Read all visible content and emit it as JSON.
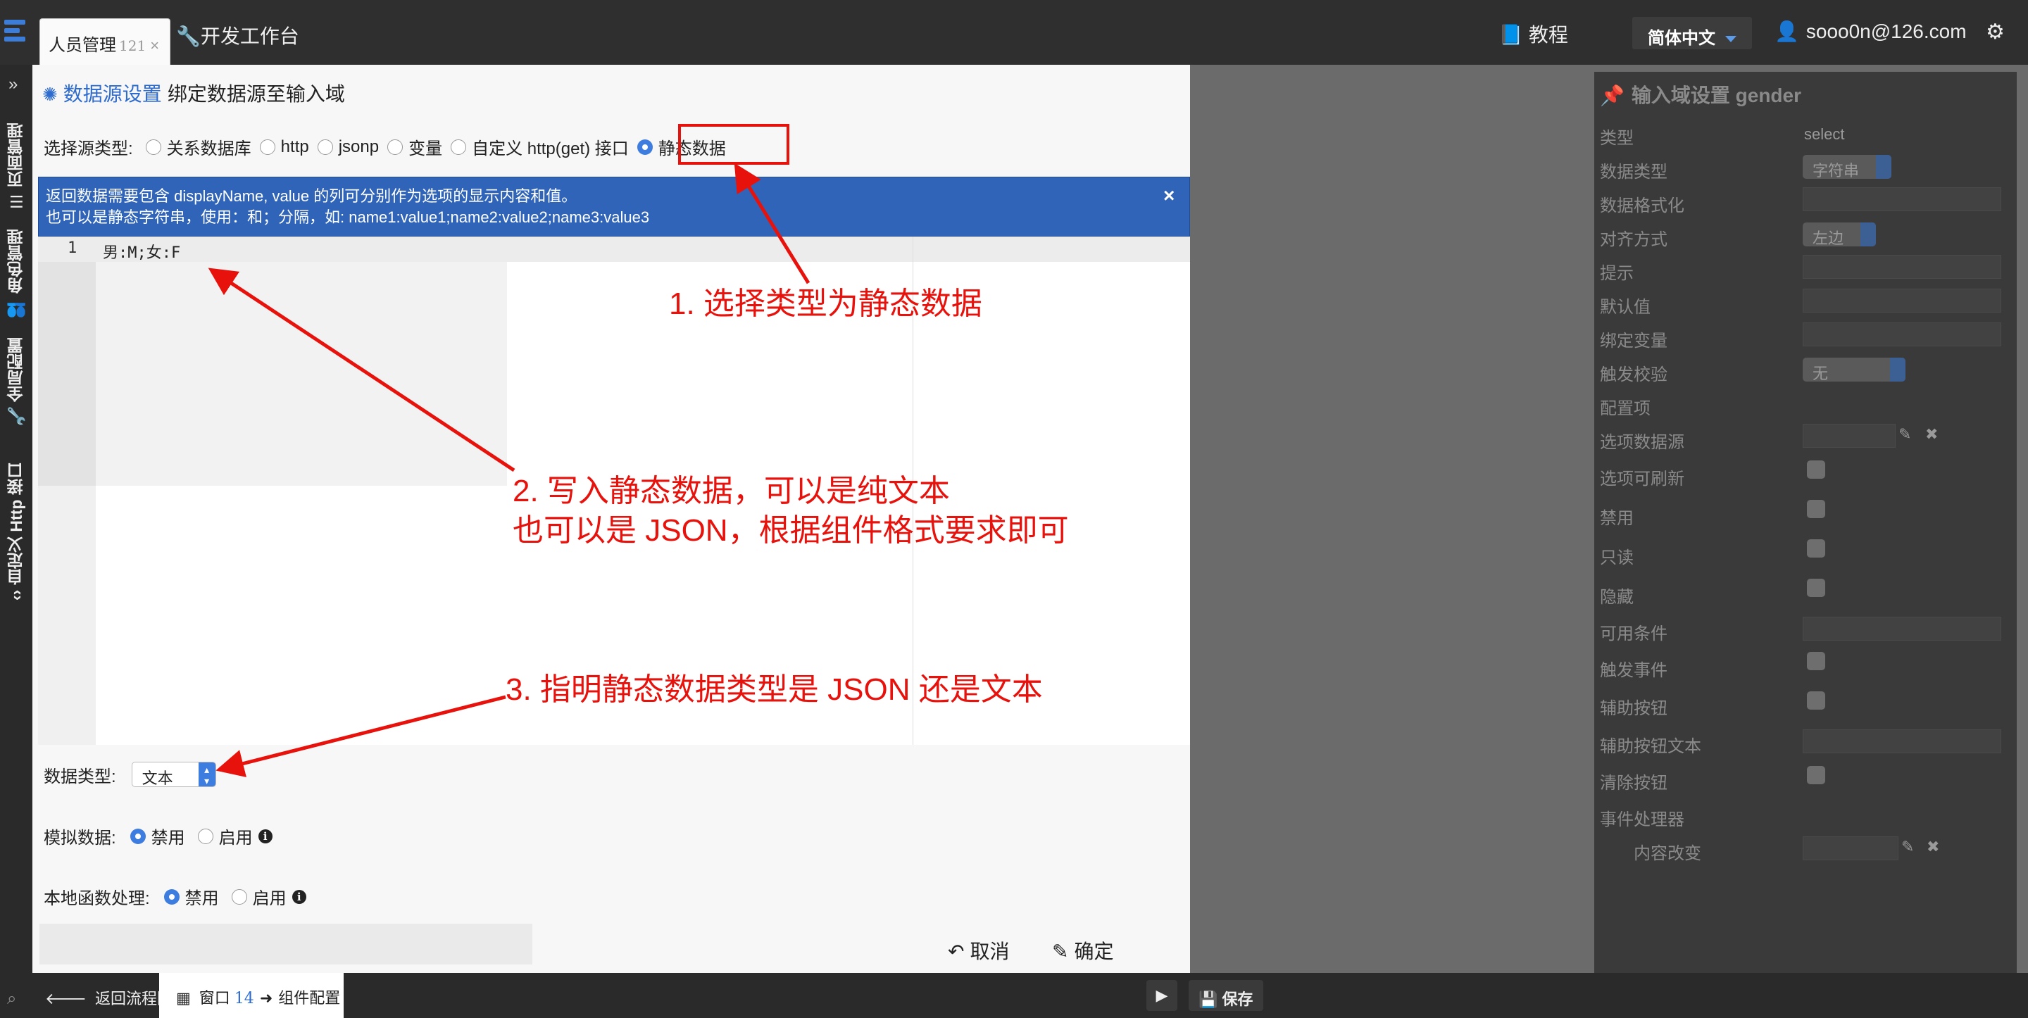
{
  "header": {
    "logo_icon": "hamburger-logo-icon",
    "tab_title": "人员管理",
    "tab_count": "121",
    "tab_close": "×",
    "devtools_label": "开发工作台",
    "tutorial_label": "教程",
    "language": "简体中文",
    "user_email": "sooo0n@126.com"
  },
  "sidebar": {
    "toggle": "»",
    "items": [
      {
        "label": "页面管理",
        "icon": "list-icon"
      },
      {
        "label": "角色管理",
        "icon": "users-icon"
      },
      {
        "label": "全局配置",
        "icon": "wrench-icon"
      },
      {
        "label": "自定义 Http 接口",
        "icon": "code-icon"
      }
    ]
  },
  "dialog": {
    "title": "数据源设置",
    "subtitle": "绑定数据源至输入域",
    "source_type_label": "选择源类型:",
    "source_options": [
      "关系数据库",
      "http",
      "jsonp",
      "变量",
      "自定义 http(get) 接口",
      "静态数据"
    ],
    "selected_source": "静态数据",
    "info_line1": "返回数据需要包含 displayName, value 的列可分别作为选项的显示内容和值。",
    "info_line2": "也可以是静态字符串，使用：和；分隔，如: name1:value1;name2:value2;name3:value3",
    "info_close": "×",
    "editor_line_number": "1",
    "editor_content": "男:M;女:F",
    "data_type_label": "数据类型:",
    "data_type_value": "文本",
    "mock_label": "模拟数据:",
    "mock_options": [
      "禁用",
      "启用"
    ],
    "local_fn_label": "本地函数处理:",
    "local_fn_options": [
      "禁用",
      "启用"
    ],
    "cancel_label": "取消",
    "ok_label": "确定"
  },
  "right_panel": {
    "title": "输入域设置 gender",
    "rows": [
      {
        "label": "类型",
        "value": "select"
      },
      {
        "label": "数据类型",
        "value": "字符串"
      },
      {
        "label": "数据格式化"
      },
      {
        "label": "对齐方式",
        "value": "左边"
      },
      {
        "label": "提示"
      },
      {
        "label": "默认值"
      },
      {
        "label": "绑定变量"
      },
      {
        "label": "触发校验",
        "value": "无"
      },
      {
        "label": "配置项"
      },
      {
        "label": "选项数据源"
      },
      {
        "label": "选项可刷新"
      },
      {
        "label": "禁用"
      },
      {
        "label": "只读"
      },
      {
        "label": "隐藏"
      },
      {
        "label": "可用条件"
      },
      {
        "label": "触发事件"
      },
      {
        "label": "辅助按钮"
      },
      {
        "label": "辅助按钮文本"
      },
      {
        "label": "清除按钮"
      },
      {
        "label": "事件处理器"
      },
      {
        "label": "内容改变"
      }
    ]
  },
  "bottom": {
    "back_label": "返回流程图",
    "window_label": "窗口",
    "window_count": "14",
    "window_target": "组件配置",
    "save_label": "保存"
  },
  "annotations": {
    "note1": "1. 选择类型为静态数据",
    "note2_line1": "2. 写入静态数据，可以是纯文本",
    "note2_line2": "也可以是 JSON，根据组件格式要求即可",
    "note3": "3. 指明静态数据类型是 JSON 还是文本",
    "color": "#e8120c"
  },
  "colors": {
    "accent": "#3d7de0",
    "info_bar": "#2f64b8",
    "topbar": "#2f2f2f"
  }
}
